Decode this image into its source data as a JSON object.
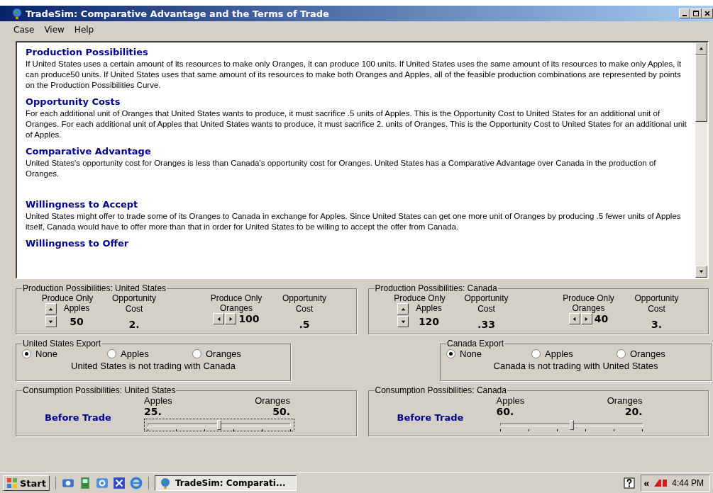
{
  "window": {
    "title": "TradeSim: Comparative Advantage and the Terms of Trade"
  },
  "menu": [
    "Case",
    "View",
    "Help"
  ],
  "report": [
    {
      "heading": "Production Possibilities",
      "text": "If United States uses a certain amount of its resources to make only Oranges, it can produce 100 units. If United States uses the same amount of its resources to make only Apples, it can produce50 units. If United States uses that same amount of its resources to make both Oranges and Apples, all of the feasible production combinations are represented by points on the Production Possibilities Curve."
    },
    {
      "heading": "Opportunity Costs",
      "text": "For each additional unit of Oranges that United States wants to produce, it must sacrifice .5 units of Apples. This is the Opportunity Cost to United States for an additional unit of Oranges. For each additional unit of Apples that United States wants to produce, it must sacrifice 2. units of Oranges. This is the Opportunity Cost to United States for an additional unit of Apples."
    },
    {
      "heading": "Comparative Advantage",
      "text": "United States's opportunity cost for Oranges is less than Canada's opportunity cost for Oranges. United States has a Comparative Advantage over Canada in the production of Oranges."
    },
    {
      "heading": "Willingness to Accept",
      "text": "United States might offer to trade some of its Oranges to Canada in exchange for Apples. Since United States can get one more unit of Oranges by producing .5 fewer units of Apples itself, Canada would have to offer more than that in order for United States to be willing to accept the offer from Canada."
    },
    {
      "heading": "Willingness to Offer"
    }
  ],
  "production": [
    {
      "title": "Production Possibilities: United States",
      "apples_label": [
        "Produce Only",
        "Apples"
      ],
      "apples": "50",
      "apples_cost_label": "Opportunity Cost",
      "apples_cost": "2.",
      "oranges_label": [
        "Produce Only",
        "Oranges"
      ],
      "oranges": "100",
      "oranges_cost_label": "Opportunity Cost",
      "oranges_cost": ".5"
    },
    {
      "title": "Production Possibilities: Canada",
      "apples_label": [
        "Produce Only",
        "Apples"
      ],
      "apples": "120",
      "apples_cost_label": "Opportunity Cost",
      "apples_cost": ".33",
      "oranges_label": [
        "Produce Only",
        "Oranges"
      ],
      "oranges": "40",
      "oranges_cost_label": "Opportunity Cost",
      "oranges_cost": "3."
    }
  ],
  "exports": [
    {
      "title": "United States Export",
      "options": [
        {
          "label": "None",
          "selected": true
        },
        {
          "label": "Apples",
          "selected": false
        },
        {
          "label": "Oranges",
          "selected": false
        }
      ],
      "status": "United States is not trading with Canada"
    },
    {
      "title": "Canada Export",
      "options": [
        {
          "label": "None",
          "selected": true
        },
        {
          "label": "Apples",
          "selected": false
        },
        {
          "label": "Oranges",
          "selected": false
        }
      ],
      "status": "Canada is not trading with United States"
    }
  ],
  "consumption": [
    {
      "title": "Consumption Possibilities: United States",
      "label": "Before Trade",
      "apples_label": "Apples",
      "apples": "25.",
      "oranges_label": "Oranges",
      "oranges": "50.",
      "level": 0.5,
      "focused": true
    },
    {
      "title": "Consumption Possibilities: Canada",
      "label": "Before Trade",
      "apples_label": "Apples",
      "apples": "60.",
      "oranges_label": "Oranges",
      "oranges": "20.",
      "level": 0.5,
      "focused": false
    }
  ],
  "taskbar": {
    "start": "Start",
    "task": "TradeSim: Comparati...",
    "clock": "4:44 PM",
    "chevron": "«"
  }
}
